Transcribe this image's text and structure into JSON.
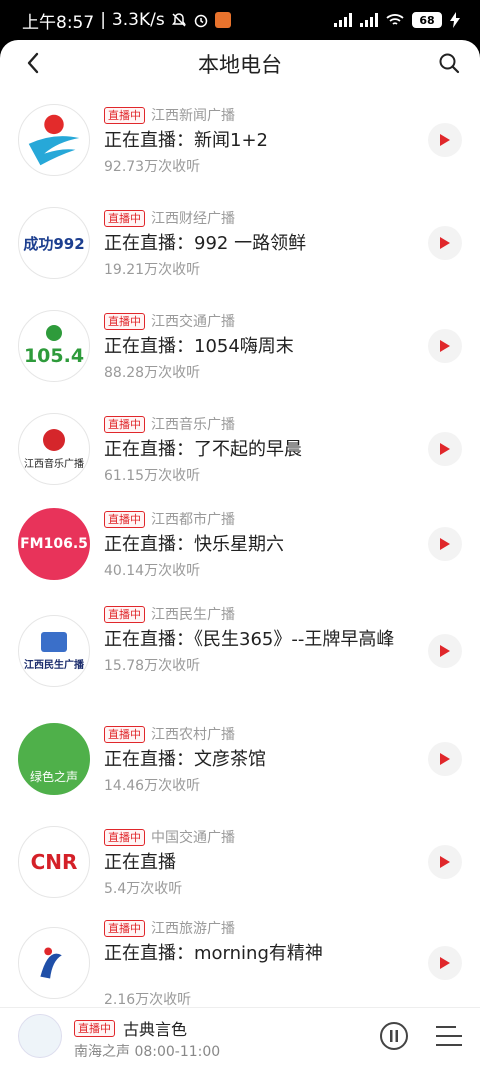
{
  "status_bar": {
    "time": "上午8:57",
    "speed": "3.3K/s",
    "battery": "68"
  },
  "header": {
    "title": "本地电台"
  },
  "live_badge": "直播中",
  "items": [
    {
      "station": "江西新闻广播",
      "now": "正在直播：新闻1+2",
      "listens": "92.73万次收听",
      "logo_text": ""
    },
    {
      "station": "江西财经广播",
      "now": "正在直播：992 一路领鲜",
      "listens": "19.21万次收听",
      "logo_text": "成功992"
    },
    {
      "station": "江西交通广播",
      "now": "正在直播：1054嗨周末",
      "listens": "88.28万次收听",
      "logo_text": "105.4"
    },
    {
      "station": "江西音乐广播",
      "now": "正在直播：了不起的早晨",
      "listens": "61.15万次收听",
      "logo_text": "江西音乐广播"
    },
    {
      "station": "江西都市广播",
      "now": "正在直播：快乐星期六",
      "listens": "40.14万次收听",
      "logo_text": "FM106.5"
    },
    {
      "station": "江西民生广播",
      "now": "正在直播：《民生365》--王牌早高峰",
      "listens": "15.78万次收听",
      "logo_text": "江西民生广播"
    },
    {
      "station": "江西农村广播",
      "now": "正在直播：文彦茶馆",
      "listens": "14.46万次收听",
      "logo_text": "绿色之声"
    },
    {
      "station": "中国交通广播",
      "now": "正在直播",
      "listens": "5.4万次收听",
      "logo_text": "CNR"
    },
    {
      "station": "江西旅游广播",
      "now": "正在直播：morning有精神",
      "listens": "2.16万次收听",
      "logo_text": ""
    }
  ],
  "mini_player": {
    "badge": "直播中",
    "title": "古典言色",
    "subtitle": "南海之声 08:00-11:00"
  },
  "colors": {
    "accent": "#e0272b",
    "title_text": "#222222",
    "secondary_text": "#9a9a9a"
  }
}
